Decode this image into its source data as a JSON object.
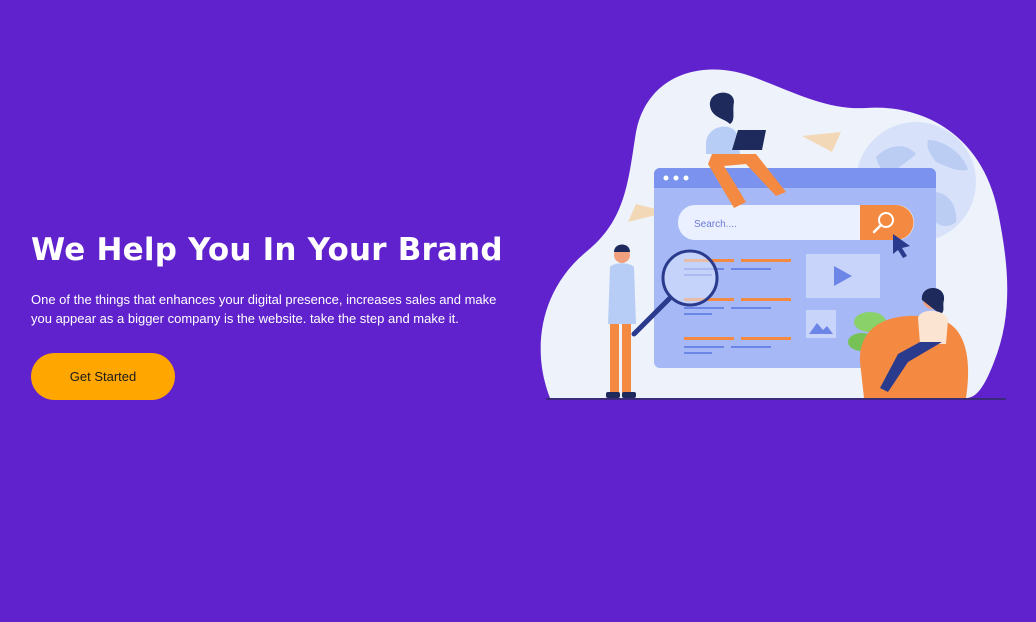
{
  "hero": {
    "title": "We Help You In Your Brand",
    "description": "One of the things that enhances your digital presence, increases sales and make you appear as a bigger company is the website. take the step and make it.",
    "cta_label": "Get Started"
  },
  "illustration": {
    "search_placeholder": "Search...."
  },
  "colors": {
    "background": "#5f22cc",
    "accent": "#ffa600",
    "illustration_blob": "#eef3fb",
    "browser_window": "#a6b8f5",
    "browser_bar": "#7b93ee",
    "search_button": "#f48a42"
  }
}
